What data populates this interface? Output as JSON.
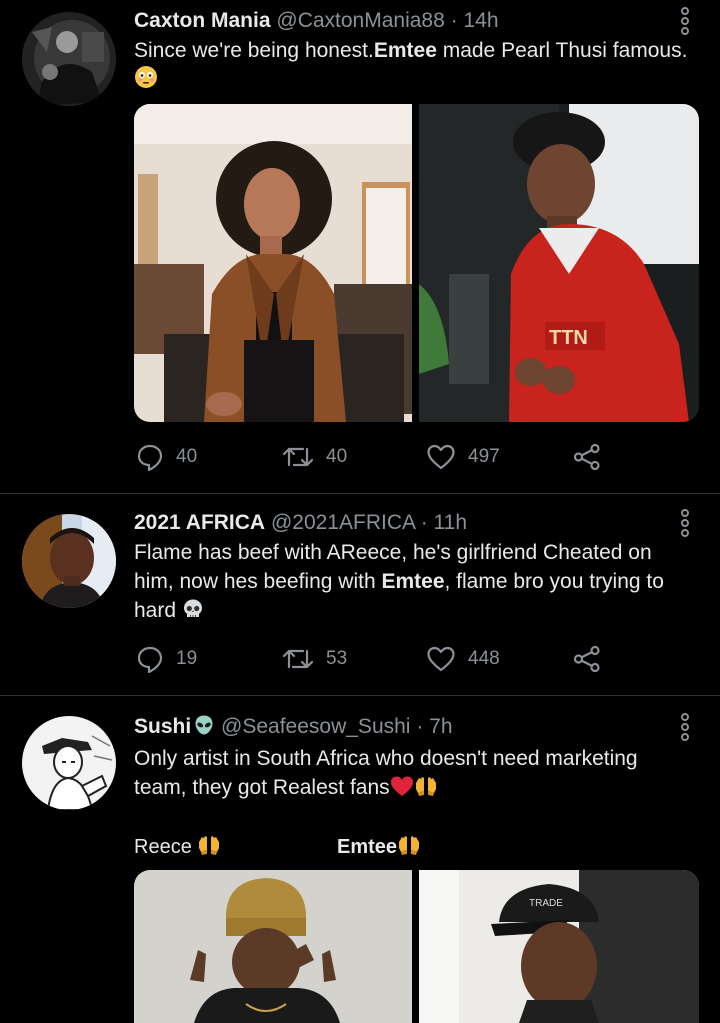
{
  "tweets": [
    {
      "name": "Caxton Mania",
      "handle": "@CaxtonMania88",
      "separator": "·",
      "time": "14h",
      "text_before": "Since we're being honest.",
      "text_bold": "Emtee",
      "text_after": " made Pearl Thusi famous.",
      "emoji": "flushed-face",
      "replies": "40",
      "retweets": "40",
      "likes": "497"
    },
    {
      "name": "2021 AFRICA",
      "handle": "@2021AFRICA",
      "separator": "·",
      "time": "11h",
      "text_before": "Flame has beef with AReece, he's girlfriend Cheated on him, now hes beefing with ",
      "text_bold": "Emtee",
      "text_after": ", flame bro you trying to hard ",
      "emoji": "skull",
      "replies": "19",
      "retweets": "53",
      "likes": "448"
    },
    {
      "name": "Sushi",
      "name_emoji": "alien",
      "handle": "@Seafeesow_Sushi",
      "separator": "·",
      "time": "7h",
      "text": "Only artist in South Africa who doesn't need marketing team, they got Realest fans",
      "emoji": "heart-raising-hands",
      "label_left": "Reece",
      "label_right": "Emtee"
    }
  ],
  "colors": {
    "background": "#000000",
    "text": "#e7e9ea",
    "secondary": "#8b9196",
    "divider": "#2f3336"
  }
}
